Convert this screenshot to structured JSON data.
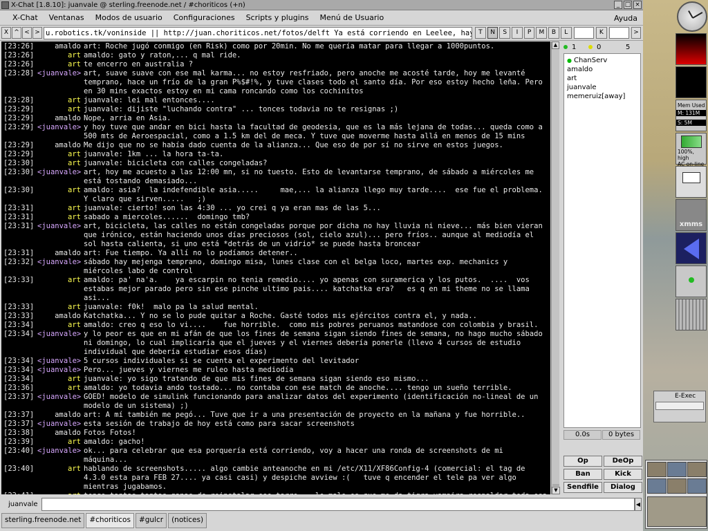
{
  "window": {
    "title": "X-Chat [1.8.10]: juanvale @ sterling.freenode.net / #choriticos (+n)"
  },
  "menu": [
    "X-Chat",
    "Ventanas",
    "Modos de usuario",
    "Configuraciones",
    "Scripts y plugins",
    "Menú de Usuario"
  ],
  "menu_help": "Ayuda",
  "topicbar": {
    "left_buttons": [
      "X",
      "^",
      "<",
      ">"
    ],
    "topic": "u.robotics.tk/voninside || http://juan.choriticos.net/fotos/delft Ya está corriendo en Leelee, hay unos cuantos directorios nuevos",
    "mode_flags": [
      "T",
      "N",
      "S",
      "I",
      "P",
      "M",
      "B",
      "L"
    ],
    "key_flag": "K",
    "right_arrow": ">"
  },
  "chat": [
    {
      "time": "[23:26]",
      "nick": "amaldo",
      "cls": "amaldo",
      "text": "art: Roche jugó conmigo (en Risk) como por 20min. No me quería matar para llegar a 1000puntos."
    },
    {
      "time": "[23:26]",
      "nick": "art",
      "cls": "art",
      "text": "amaldo: gato y raton,... q mal ride."
    },
    {
      "time": "[23:26]",
      "nick": "art",
      "cls": "art",
      "text": "te encerro en australia ?"
    },
    {
      "time": "[23:28]",
      "nick": "<juanvale>",
      "cls": "self",
      "text": "art, suave suave con ese mal karma... no estoy resfriado, pero anoche me acosté tarde, hoy me levanté temprano, hace un frío de la gran P%$#!%, y tuve clases todo el santo día. Por eso estoy hecho leña. Pero en 30 mins exactos estoy en mi cama roncando como los cochinitos"
    },
    {
      "time": "[23:28]",
      "nick": "art",
      "cls": "art",
      "text": "juanvale: lei mal entonces...."
    },
    {
      "time": "[23:29]",
      "nick": "art",
      "cls": "art",
      "text": "juanvale: dijiste \"luchando contra\" ... tonces todavia no te resignas ;)"
    },
    {
      "time": "[23:29]",
      "nick": "amaldo",
      "cls": "amaldo",
      "text": "Nope, arria en Asia."
    },
    {
      "time": "[23:29]",
      "nick": "<juanvale>",
      "cls": "self",
      "text": "y hoy tuve que andar en bici hasta la facultad de geodesia, que es la más lejana de todas... queda como a 500 mts de Aeroespacial, como a 1.5 km del de meca. Y tuve que moverme hasta allá en menos de 15 mins"
    },
    {
      "time": "[23:29]",
      "nick": "amaldo",
      "cls": "amaldo",
      "text": "Me dijo que no se había dado cuenta de la alianza... Que eso de por sí no sirve en estos juegos."
    },
    {
      "time": "[23:29]",
      "nick": "art",
      "cls": "art",
      "text": "juanvale: 1km ... la hora ta-ta."
    },
    {
      "time": "[23:30]",
      "nick": "art",
      "cls": "art",
      "text": "juanvale: bicicleta con calles congeladas?"
    },
    {
      "time": "[23:30]",
      "nick": "<juanvale>",
      "cls": "self",
      "text": "art, hoy me acuesto a las 12:00 mn, si no tuesto. Esto de levantarse temprano, de sábado a miércoles me está tostando demasiado..."
    },
    {
      "time": "[23:30]",
      "nick": "art",
      "cls": "art",
      "text": "amaldo: asia?  la indefendible asia.....     mae,... la alianza llego muy tarde....  ese fue el problema.  Y claro que sirven.....   ;)"
    },
    {
      "time": "[23:31]",
      "nick": "art",
      "cls": "art",
      "text": "juanvale: cierto! son las 4:30 ... yo crei q ya eran mas de las 5..."
    },
    {
      "time": "[23:31]",
      "nick": "art",
      "cls": "art",
      "text": "sabado a miercoles......  domingo tmb?"
    },
    {
      "time": "[23:31]",
      "nick": "<juanvale>",
      "cls": "self",
      "text": "art, bicicleta, las calles no están congeladas porque por dicha no hay lluvia ni nieve... más bien vieran que irónico, están haciendo unos días preciosos (sol, cielo azul)... pero fríos.. aunque al mediodía el sol hasta calienta, si uno está *detrás de un vidrio* se puede hasta broncear"
    },
    {
      "time": "[23:31]",
      "nick": "amaldo",
      "cls": "amaldo",
      "text": "art: Fue tiempo. Ya allí no lo podíamos detener.."
    },
    {
      "time": "[23:32]",
      "nick": "<juanvale>",
      "cls": "self",
      "text": "sábado hay mejenga temprano, domingo misa, lunes clase con el belga loco, martes exp. mechanics y miércoles labo de control"
    },
    {
      "time": "[23:33]",
      "nick": "art",
      "cls": "art",
      "text": "amaldo: pa' na'a.    ya escarpin no tenia remedio.... yo apenas con suramerica y los putos.  ....  vos estabas mejor parado pero sin ese pinche ultimo pais.... katchatka era?   es q en mi theme no se llama asi..."
    },
    {
      "time": "[23:33]",
      "nick": "art",
      "cls": "art",
      "text": "juanvale: f0k!  malo pa la salud mental."
    },
    {
      "time": "[23:33]",
      "nick": "amaldo",
      "cls": "amaldo",
      "text": "Katchatka... Y no se lo pude quitar a Roche. Gasté todos mis ejércitos contra el, y nada.."
    },
    {
      "time": "[23:34]",
      "nick": "art",
      "cls": "art",
      "text": "amaldo: creo q eso lo vi....    fue horrible.  como mis pobres peruanos matandose con colombia y brasil."
    },
    {
      "time": "[23:34]",
      "nick": "<juanvale>",
      "cls": "self",
      "text": "y lo peor es que en mi afán de que los fines de semana sigan siendo fines de semana, no hago mucho sábado ni domingo, lo cual implicaría que el jueves y el viernes debería ponerle (llevo 4 cursos de estudio individual que debería estudiar esos días)"
    },
    {
      "time": "[23:34]",
      "nick": "<juanvale>",
      "cls": "self",
      "text": "5 cursos individuales si se cuenta el experimento del levitador"
    },
    {
      "time": "[23:34]",
      "nick": "<juanvale>",
      "cls": "self",
      "text": "Pero... jueves y viernes me ruleo hasta mediodía"
    },
    {
      "time": "[23:34]",
      "nick": "art",
      "cls": "art",
      "text": "juanvale: yo sigo tratando de que mis fines de semana sigan siendo eso mismo..."
    },
    {
      "time": "[23:36]",
      "nick": "art",
      "cls": "art",
      "text": "amaldo: yo todavia ando tostado... no contaba con ese match de anoche.... tengo un sueño terrible."
    },
    {
      "time": "[23:37]",
      "nick": "<juanvale>",
      "cls": "self",
      "text": "GOED! modelo de simulink funcionando para analizar datos del experimento (identificación no-lineal de un modelo de un sistema) ;)"
    },
    {
      "time": "[23:37]",
      "nick": "amaldo",
      "cls": "amaldo",
      "text": "art: A mí también me pegó... Tuve que ir a una presentación de proyecto en la mañana y fue horrible.."
    },
    {
      "time": "[23:37]",
      "nick": "<juanvale>",
      "cls": "self",
      "text": "esta sesión de trabajo de hoy está como para sacar screenshots"
    },
    {
      "time": "[23:38]",
      "nick": "amaldo",
      "cls": "amaldo",
      "text": "Fotos Fotos!"
    },
    {
      "time": "[23:39]",
      "nick": "art",
      "cls": "art",
      "text": "amaldo: gacho!"
    },
    {
      "time": "[23:40]",
      "nick": "<juanvale>",
      "cls": "self",
      "text": "ok... para celebrar que esa porquería está corriendo, voy a hacer una ronda de screenshots de mi máquina..."
    },
    {
      "time": "[23:40]",
      "nick": "art",
      "cls": "art",
      "text": "hablando de screenshots..... algo cambie anteanoche en mi /etc/X11/XF86Config-4 (comercial: el tag de 4.3.0 esta para FEB 27.... ya casi casi) y despiche avview :(   tuve q encender el tele pa ver algo mientras jugabamos."
    },
    {
      "time": "[23:41]",
      "nick": "art",
      "cls": "art",
      "text": "tengo tantas tantas ganas de reinstalar ese tarro... lo malo es que me da tigra vampira respaldar toda esa musica...."
    }
  ],
  "userlist": {
    "counts": [
      "1",
      "0",
      "5"
    ],
    "users": [
      {
        "name": "ChanServ",
        "op": true
      },
      {
        "name": "amaldo",
        "op": false
      },
      {
        "name": "art",
        "op": false
      },
      {
        "name": "juanvale",
        "op": false
      },
      {
        "name": "memeruiz[away]",
        "op": false
      }
    ],
    "lag": "0.0s",
    "bytes": "0 bytes"
  },
  "buttons": {
    "op": "Op",
    "deop": "DeOp",
    "ban": "Ban",
    "kick": "Kick",
    "sendfile": "Sendfile",
    "dialog": "Dialog"
  },
  "input": {
    "nick": "juanvale",
    "value": ""
  },
  "tabs": [
    {
      "label": "sterling.freenode.net",
      "active": false
    },
    {
      "label": "#choriticos",
      "active": true
    },
    {
      "label": "#gulcr",
      "active": false
    },
    {
      "label": "(notices)",
      "active": false
    }
  ],
  "dock": {
    "mem_title": "Mem Used",
    "mem_m": "M: 131M",
    "mem_s": "S: 5M",
    "battery_line1": "100%, high",
    "battery_line2": "AC on-line",
    "xmms_label": "xmms",
    "eexec_label": "E-Exec"
  }
}
